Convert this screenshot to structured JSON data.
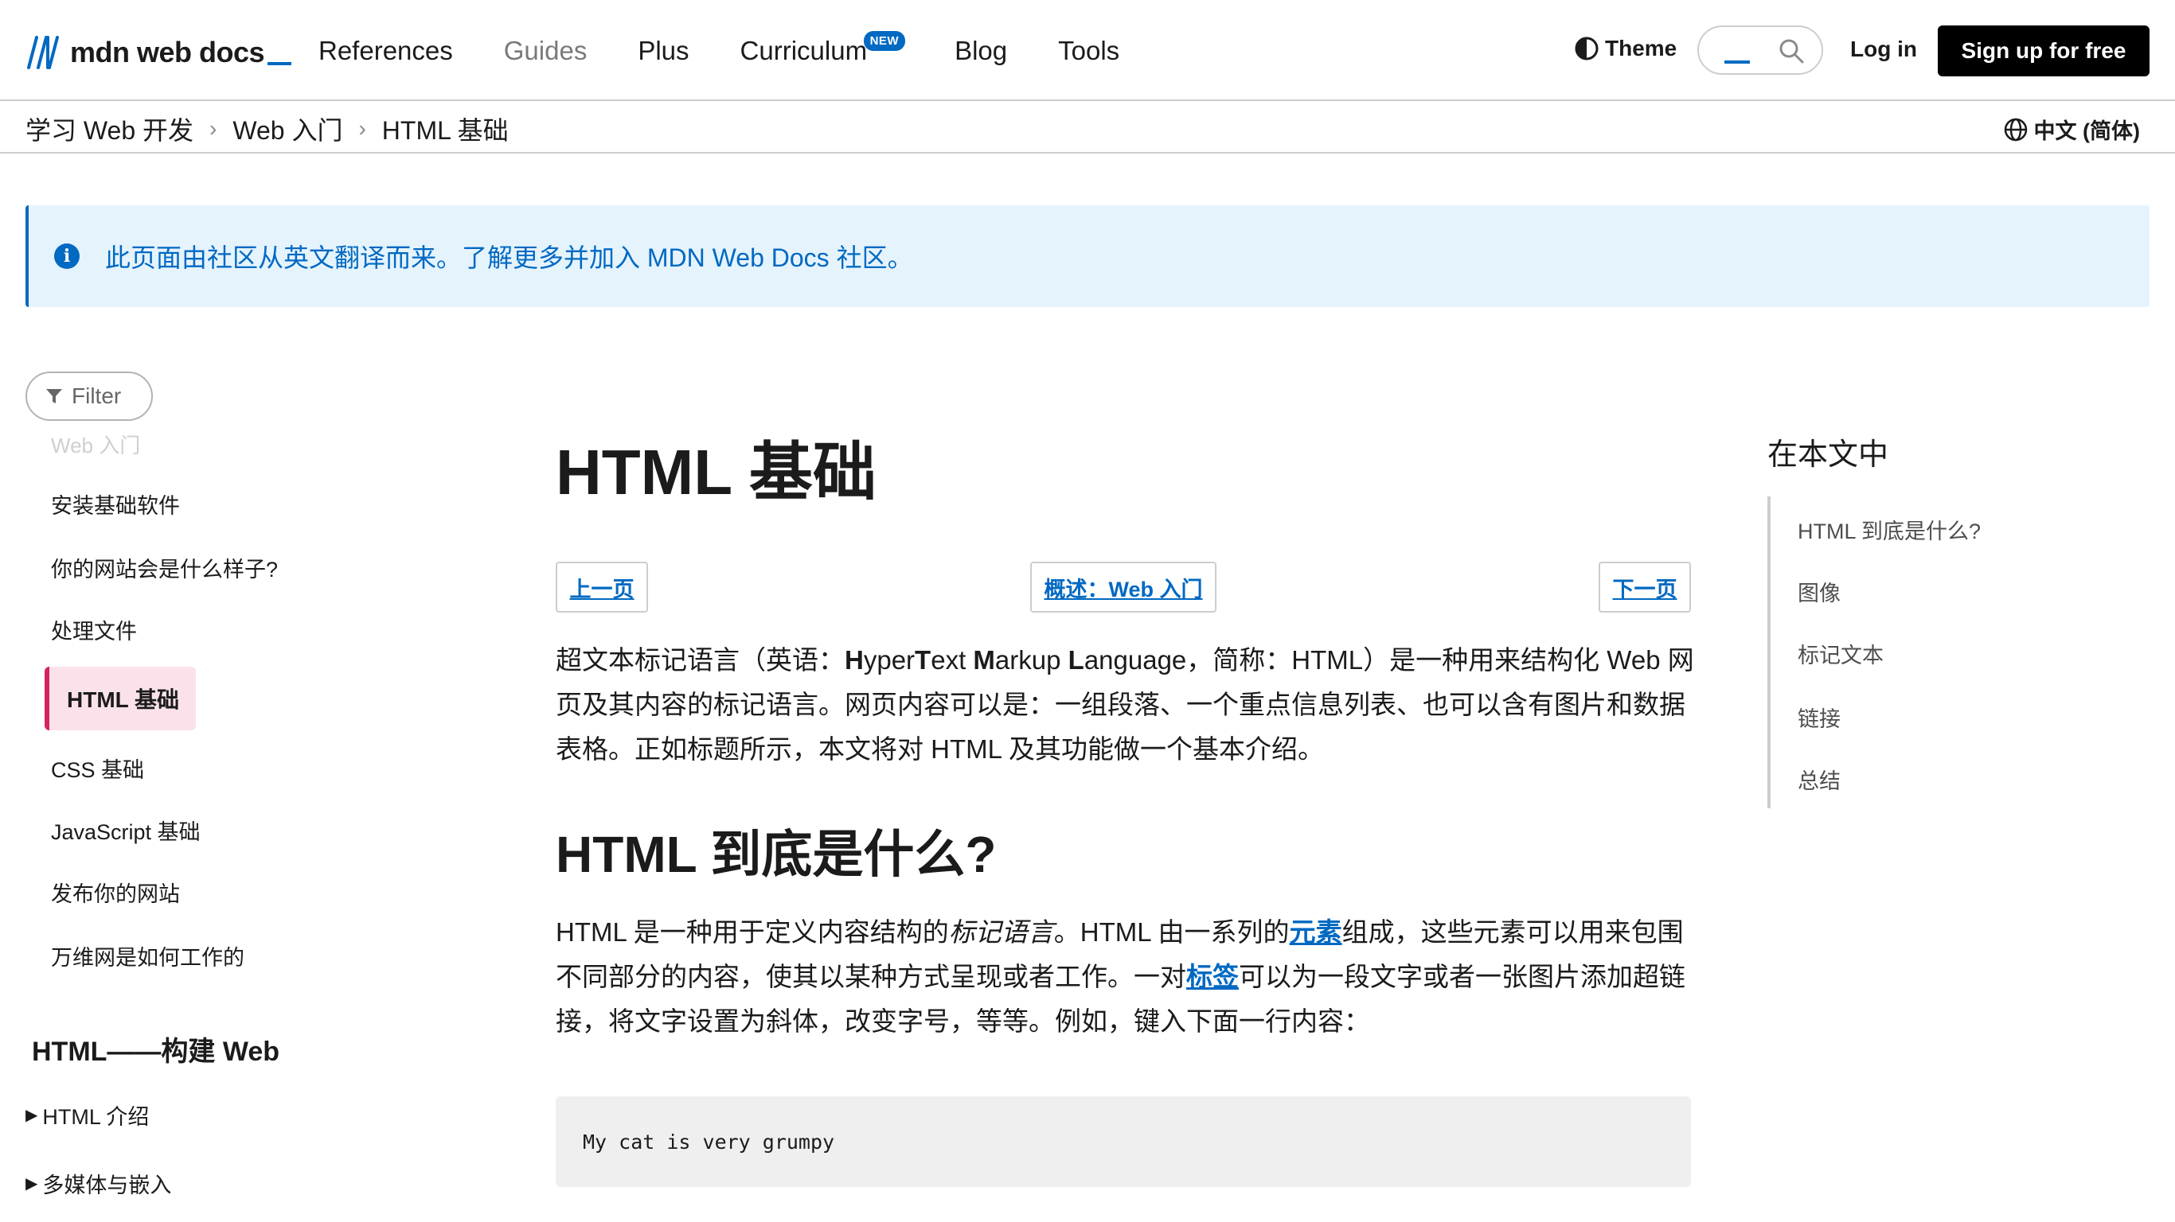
{
  "header": {
    "logo_text": "mdn web docs",
    "nav": [
      {
        "label": "References"
      },
      {
        "label": "Guides"
      },
      {
        "label": "Plus"
      },
      {
        "label": "Curriculum",
        "badge": "NEW"
      },
      {
        "label": "Blog"
      },
      {
        "label": "Tools"
      }
    ],
    "theme_label": "Theme",
    "login_label": "Log in",
    "signup_label": "Sign up for free"
  },
  "breadcrumb": {
    "items": [
      "学习 Web 开发",
      "Web 入门",
      "HTML 基础"
    ],
    "separator": "›",
    "language": "中文 (简体)"
  },
  "notice": {
    "text": "此页面由社区从英文翻译而来。了解更多并加入 MDN Web Docs 社区。"
  },
  "sidebar": {
    "filter_label": "Filter",
    "faded_item": "Web 入门",
    "items": [
      "安装基础软件",
      "你的网站会是什么样子?",
      "处理文件",
      "HTML 基础",
      "CSS 基础",
      "JavaScript 基础",
      "发布你的网站",
      "万维网是如何工作的"
    ],
    "active_index": 3,
    "section_title": "HTML——构建 Web",
    "expanders": [
      "HTML 介绍",
      "多媒体与嵌入"
    ]
  },
  "main": {
    "title": "HTML 基础",
    "pager": {
      "prev": "上一页",
      "overview": "概述：Web 入门",
      "next": "下一页"
    },
    "intro": {
      "p1": "超文本标记语言（英语：",
      "H": "H",
      "yper": "yper",
      "T": "T",
      "ext": "ext ",
      "M": "M",
      "arkup": "arkup ",
      "L": "L",
      "anguage": "anguage",
      "p2": "，简称：HTML）是一种用来结构化 Web 网页及其内容的标记语言。网页内容可以是：一组段落、一个重点信息列表、也可以含有图片和数据表格。正如标题所示，本文将对 HTML 及其功能做一个基本介绍。"
    },
    "h2": "HTML 到底是什么?",
    "what": {
      "t1": "HTML 是一种用于定义内容结构的",
      "em": "标记语言",
      "t2": "。HTML 由一系列的",
      "link1": "元素",
      "t3": "组成，这些元素可以用来包围不同部分的内容，使其以某种方式呈现或者工作。一对",
      "link2": "标签",
      "t4": "可以为一段文字或者一张图片添加超链接，将文字设置为斜体，改变字号，等等。例如，键入下面一行内容："
    },
    "code": "My cat is very grumpy"
  },
  "toc": {
    "title": "在本文中",
    "items": [
      "HTML 到底是什么?",
      "图像",
      "标记文本",
      "链接",
      "总结"
    ]
  },
  "colors": {
    "accent": "#0069c2",
    "active_bg": "#fbe2ea",
    "active_border": "#d5245f",
    "notice_bg": "#e5f3fd"
  }
}
